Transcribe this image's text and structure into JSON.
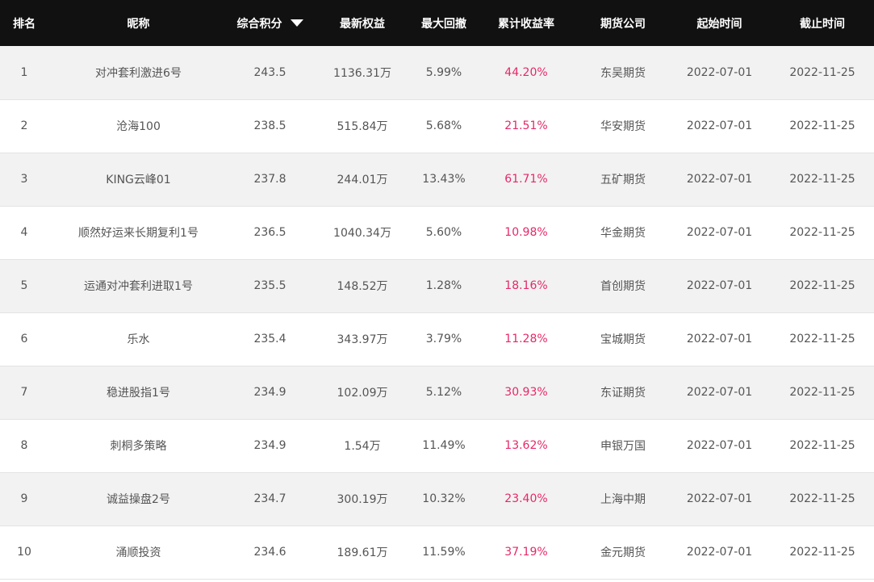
{
  "header": {
    "rank": "排名",
    "name": "昵称",
    "score": "综合积分",
    "equity": "最新权益",
    "max_drawdown": "最大回撤",
    "cumulative_return": "累计收益率",
    "company": "期货公司",
    "start_time": "起始时间",
    "end_time": "截止时间",
    "sort_icon": "triangle-down-icon"
  },
  "colors": {
    "header_bg": "#111111",
    "row_alt_bg": "#f2f2f2",
    "return_color": "#e5286a",
    "text_color": "#555555"
  },
  "rows": [
    {
      "rank": "1",
      "name": "对冲套利激进6号",
      "score": "243.5",
      "equity": "1136.31万",
      "max_drawdown": "5.99%",
      "cumulative_return": "44.20%",
      "company": "东吴期货",
      "start_time": "2022-07-01",
      "end_time": "2022-11-25"
    },
    {
      "rank": "2",
      "name": "沧海100",
      "score": "238.5",
      "equity": "515.84万",
      "max_drawdown": "5.68%",
      "cumulative_return": "21.51%",
      "company": "华安期货",
      "start_time": "2022-07-01",
      "end_time": "2022-11-25"
    },
    {
      "rank": "3",
      "name": "KING云峰01",
      "score": "237.8",
      "equity": "244.01万",
      "max_drawdown": "13.43%",
      "cumulative_return": "61.71%",
      "company": "五矿期货",
      "start_time": "2022-07-01",
      "end_time": "2022-11-25"
    },
    {
      "rank": "4",
      "name": "顺然好运来长期复利1号",
      "score": "236.5",
      "equity": "1040.34万",
      "max_drawdown": "5.60%",
      "cumulative_return": "10.98%",
      "company": "华金期货",
      "start_time": "2022-07-01",
      "end_time": "2022-11-25"
    },
    {
      "rank": "5",
      "name": "运通对冲套利进取1号",
      "score": "235.5",
      "equity": "148.52万",
      "max_drawdown": "1.28%",
      "cumulative_return": "18.16%",
      "company": "首创期货",
      "start_time": "2022-07-01",
      "end_time": "2022-11-25"
    },
    {
      "rank": "6",
      "name": "乐水",
      "score": "235.4",
      "equity": "343.97万",
      "max_drawdown": "3.79%",
      "cumulative_return": "11.28%",
      "company": "宝城期货",
      "start_time": "2022-07-01",
      "end_time": "2022-11-25"
    },
    {
      "rank": "7",
      "name": "稳进股指1号",
      "score": "234.9",
      "equity": "102.09万",
      "max_drawdown": "5.12%",
      "cumulative_return": "30.93%",
      "company": "东证期货",
      "start_time": "2022-07-01",
      "end_time": "2022-11-25"
    },
    {
      "rank": "8",
      "name": "刺桐多策略",
      "score": "234.9",
      "equity": "1.54万",
      "max_drawdown": "11.49%",
      "cumulative_return": "13.62%",
      "company": "申银万国",
      "start_time": "2022-07-01",
      "end_time": "2022-11-25"
    },
    {
      "rank": "9",
      "name": "诚益操盘2号",
      "score": "234.7",
      "equity": "300.19万",
      "max_drawdown": "10.32%",
      "cumulative_return": "23.40%",
      "company": "上海中期",
      "start_time": "2022-07-01",
      "end_time": "2022-11-25"
    },
    {
      "rank": "10",
      "name": "涌顺投资",
      "score": "234.6",
      "equity": "189.61万",
      "max_drawdown": "11.59%",
      "cumulative_return": "37.19%",
      "company": "金元期货",
      "start_time": "2022-07-01",
      "end_time": "2022-11-25"
    }
  ]
}
